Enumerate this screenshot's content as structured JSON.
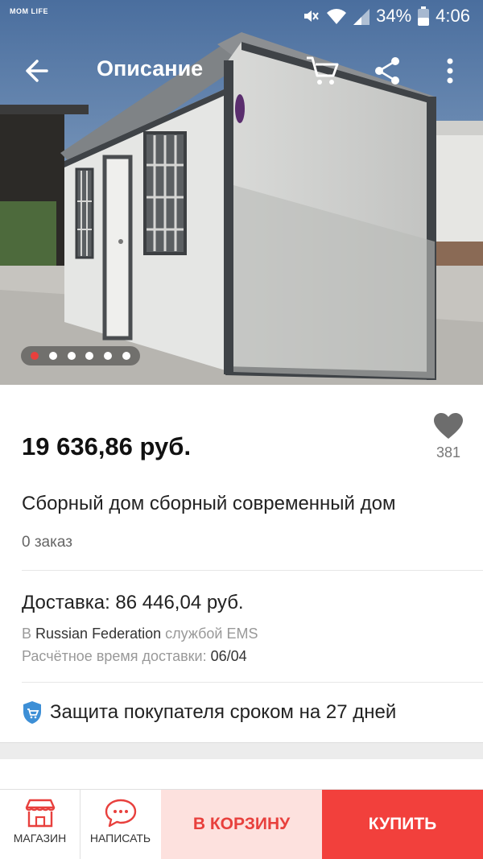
{
  "status_bar": {
    "brand": "MOM LIFE",
    "battery": "34%",
    "time": "4:06"
  },
  "app_bar": {
    "title": "Описание",
    "back_icon": "arrow-left-icon",
    "cart_icon": "cart-icon",
    "share_icon": "share-icon",
    "more_icon": "more-vertical-icon"
  },
  "gallery": {
    "image": "prefab container house photo",
    "dots_total": 6,
    "active_index": 0
  },
  "product": {
    "price": "19 636,86 руб.",
    "wishlist_count": "381",
    "title": "Сборный дом сборный современный дом",
    "orders": "0 заказ"
  },
  "shipping": {
    "cost": "Доставка: 86 446,04 руб.",
    "prefix": "В",
    "country": "Russian Federation",
    "service": "службой EMS",
    "eta_label": "Расчётное время доставки:",
    "eta_value": "06/04"
  },
  "protection": {
    "text": "Защита покупателя сроком на 27 дней",
    "icon": "shield-cart-icon"
  },
  "bottom_bar": {
    "shop_label": "МАГАЗИН",
    "message_label": "НАПИСАТЬ",
    "add_to_cart_label": "В КОРЗИНУ",
    "buy_label": "КУПИТЬ"
  },
  "colors": {
    "accent": "#f2403c",
    "accent_light": "#fde1de",
    "text": "#222222",
    "muted": "#999999"
  }
}
